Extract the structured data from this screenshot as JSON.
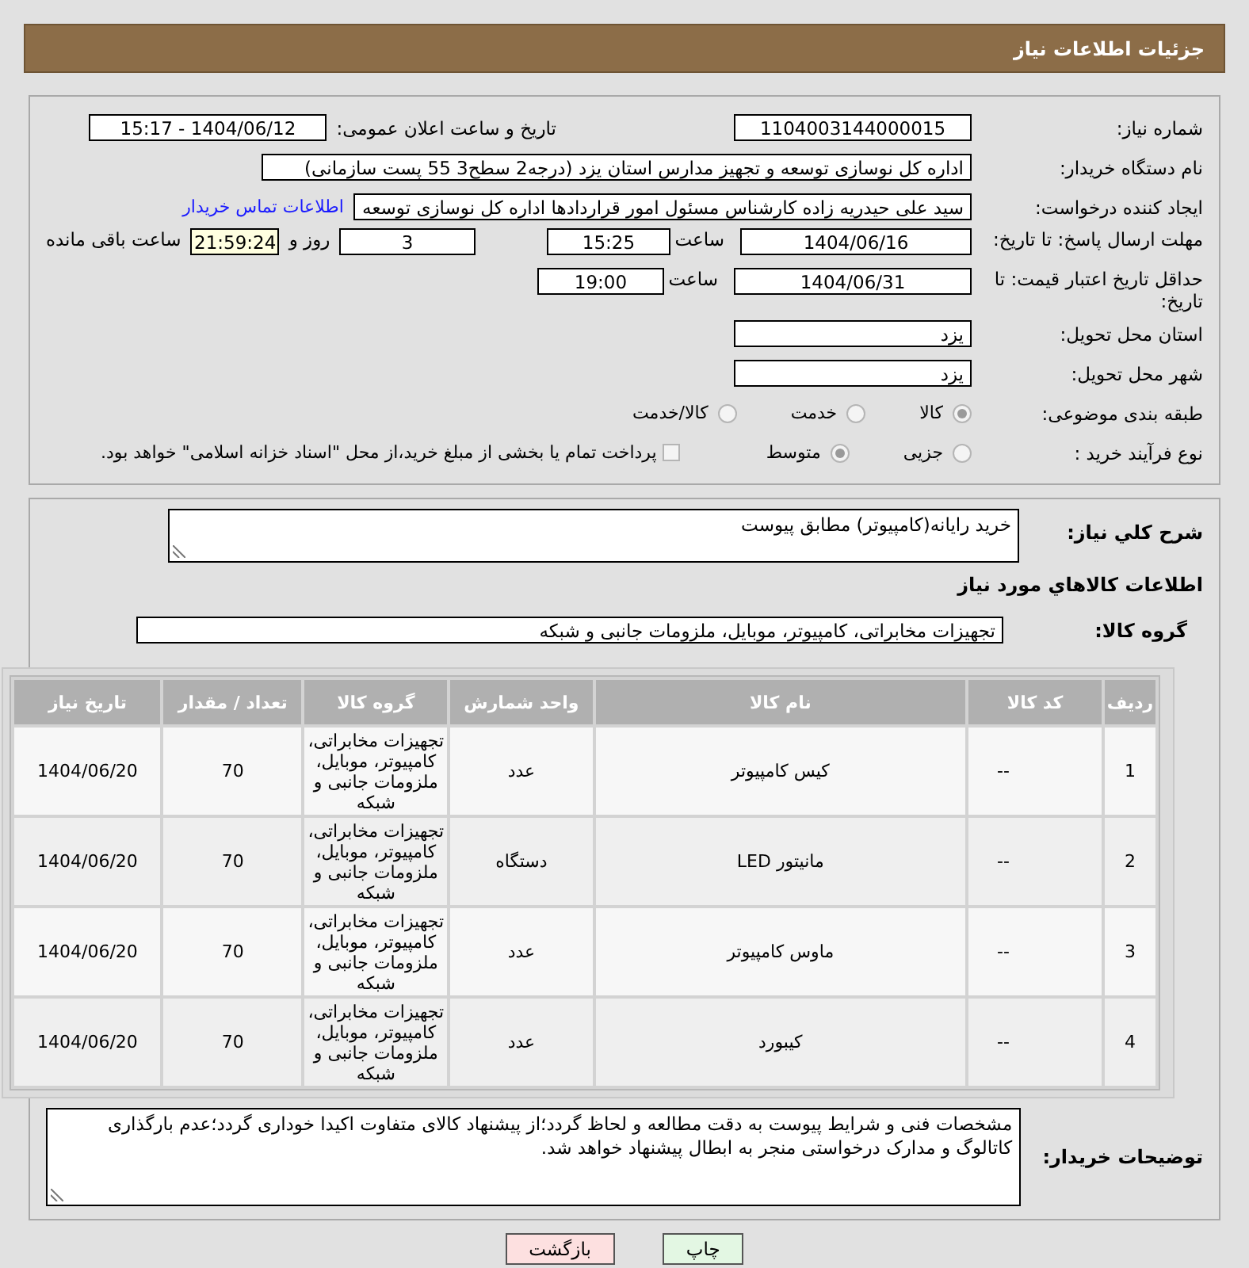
{
  "header": {
    "title": "جزئیات اطلاعات نیاز"
  },
  "need_number": {
    "label": "شماره نیاز:",
    "value": "1104003144000015"
  },
  "announce": {
    "label": "تاریخ و ساعت اعلان عمومی:",
    "value": "1404/06/12 - 15:17"
  },
  "buyer": {
    "label": "نام دستگاه خریدار:",
    "value": "اداره کل نوسازی   توسعه و تجهیز مدارس استان یزد (درجه2  سطح3  55 پست سازمانی)"
  },
  "creator": {
    "label": "ایجاد کننده درخواست:",
    "value": "سید علی حیدریه زاده کارشناس مسئول امور قراردادها اداره کل نوسازی   توسعه",
    "link": "اطلاعات تماس خریدار"
  },
  "deadline": {
    "label": "مهلت ارسال پاسخ: تا تاریخ:",
    "date": "1404/06/16",
    "time_label": "ساعت",
    "time": "15:25",
    "days": "3",
    "days_label": "روز و",
    "remaining": "21:59:24",
    "remaining_label": "ساعت باقی مانده"
  },
  "validity": {
    "label": "حداقل تاریخ اعتبار قیمت: تا تاریخ:",
    "date": "1404/06/31",
    "time_label": "ساعت",
    "time": "19:00"
  },
  "province": {
    "label": "استان محل تحویل:",
    "value": "یزد"
  },
  "city": {
    "label": "شهر محل تحویل:",
    "value": "یزد"
  },
  "category": {
    "label": "طبقه بندی موضوعی:",
    "options": [
      {
        "label": "کالا",
        "selected": true
      },
      {
        "label": "خدمت",
        "selected": false
      },
      {
        "label": "کالا/خدمت",
        "selected": false
      }
    ]
  },
  "process": {
    "label": "نوع فرآیند خرید :",
    "options": [
      {
        "label": "جزیی",
        "selected": false
      },
      {
        "label": "متوسط",
        "selected": true
      }
    ],
    "checkbox": {
      "label": "پرداخت تمام یا بخشی از مبلغ خرید،از محل \"اسناد خزانه اسلامی\" خواهد بود.",
      "checked": false
    }
  },
  "summary": {
    "label": "شرح کلي نياز:",
    "value": "خرید رایانه(کامپیوتر) مطابق پیوست"
  },
  "goods_heading": "اطلاعات کالاهاي مورد نياز",
  "group": {
    "label": "گروه کالا:",
    "value": "تجهیزات مخابراتی، کامپیوتر، موبایل، ملزومات جانبی و شبکه"
  },
  "table": {
    "columns": [
      "ردیف",
      "کد کالا",
      "نام کالا",
      "واحد شمارش",
      "گروه کالا",
      "تعداد / مقدار",
      "تاریخ نیاز"
    ],
    "rows": [
      [
        "1",
        "--",
        "کیس کامپیوتر",
        "عدد",
        "تجهیزات مخابراتی، کامپیوتر، موبایل، ملزومات جانبی و شبکه",
        "70",
        "1404/06/20"
      ],
      [
        "2",
        "--",
        "مانیتور LED",
        "دستگاه",
        "تجهیزات مخابراتی، کامپیوتر، موبایل، ملزومات جانبی و شبکه",
        "70",
        "1404/06/20"
      ],
      [
        "3",
        "--",
        "ماوس کامپیوتر",
        "عدد",
        "تجهیزات مخابراتی، کامپیوتر، موبایل، ملزومات جانبی و شبکه",
        "70",
        "1404/06/20"
      ],
      [
        "4",
        "--",
        "کیبورد",
        "عدد",
        "تجهیزات مخابراتی، کامپیوتر، موبایل، ملزومات جانبی و شبکه",
        "70",
        "1404/06/20"
      ]
    ]
  },
  "notes": {
    "label": "توضیحات خریدار:",
    "value": "مشخصات فنی و شرایط پیوست به دقت مطالعه و لحاظ گردد؛از پیشنهاد کالای متفاوت اکیدا خوداری گردد؛عدم بارگذاری کاتالوگ و مدارک درخواستی منجر به ابطال پیشنهاد خواهد شد."
  },
  "buttons": [
    {
      "label": "چاپ",
      "kind": "print"
    },
    {
      "label": "بازگشت",
      "kind": "back"
    }
  ]
}
